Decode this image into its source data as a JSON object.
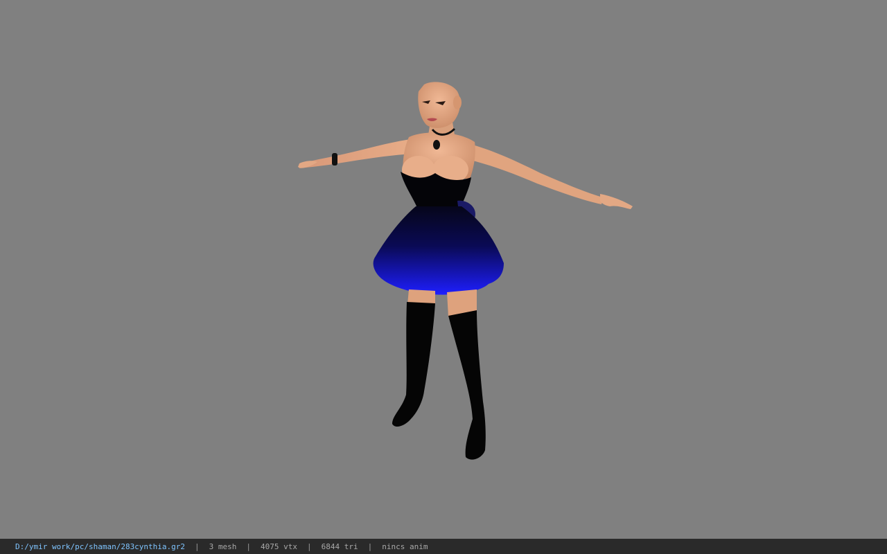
{
  "viewer": {
    "background_color": "#808080"
  },
  "model": {
    "skin_color": "#e0a07a",
    "dress_top_color": "#050510",
    "dress_skirt_color": "#1a1aff",
    "boots_color": "#050505"
  },
  "status_bar": {
    "file_path": "D:/ymir work/pc/shaman/283cynthia.gr2",
    "mesh_count": "3 mesh",
    "vertex_count": "4075 vtx",
    "triangle_count": "6844 tri",
    "animation": "nincs anim",
    "separator": "|"
  }
}
